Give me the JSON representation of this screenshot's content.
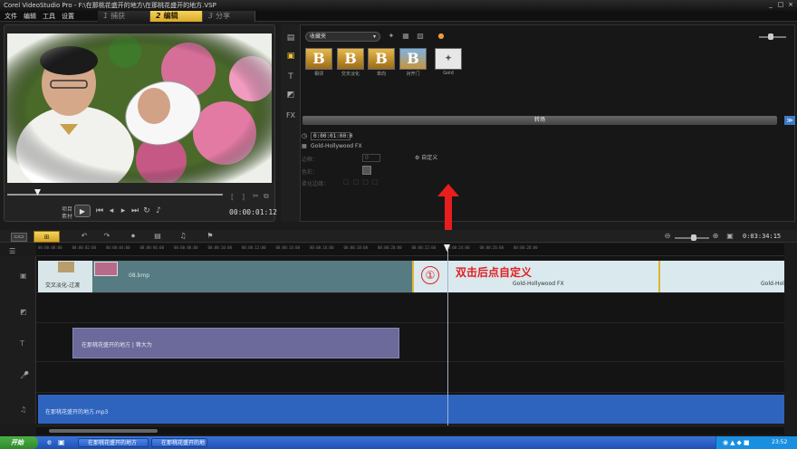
{
  "window": {
    "title": "Corel VideoStudio Pro - F:\\在那桃花盛开的地方\\在那桃花盛开的地方.VSP",
    "controls": [
      "_",
      "□",
      "×"
    ]
  },
  "menu": [
    "文件",
    "编辑",
    "工具",
    "设置"
  ],
  "steps": [
    {
      "num": "1",
      "label": "捕获"
    },
    {
      "num": "2",
      "label": "编辑"
    },
    {
      "num": "3",
      "label": "分享"
    }
  ],
  "preview": {
    "project_label": "项目",
    "clip_label": "素材",
    "timecode": "00:00:01:12"
  },
  "library": {
    "folder": "收藏夹",
    "thumbnails": [
      {
        "glyph": "B",
        "label": "相邻"
      },
      {
        "glyph": "B",
        "label": "交叉淡化"
      },
      {
        "glyph": "B",
        "label": "单向"
      },
      {
        "glyph": "B",
        "label": "对开门"
      },
      {
        "glyph": "✦",
        "label": "Gold"
      }
    ],
    "transition_header": "转场",
    "options": {
      "duration": "0:00:01:00:0",
      "effect_name": "Gold-Hollywood FX",
      "border_label": "边框：",
      "border_value": "0",
      "color_label": "色彩：",
      "soft_edge_label": "柔化边缘：",
      "custom_button": "自定义"
    }
  },
  "timeline": {
    "timecode": "0:03:34:15",
    "ruler_ticks": [
      "00:00:00:00",
      "00:00:02:00",
      "00:00:04:00",
      "00:00:06:00",
      "00:00:08:00",
      "00:00:10:00",
      "00:00:12:00",
      "00:00:14:00",
      "00:00:16:00",
      "00:00:18:00",
      "00:00:20:00",
      "00:00:22:00",
      "00:00:24:00",
      "00:00:26:00",
      "00:00:28:00"
    ],
    "video_track": {
      "clip1": "交叉淡化-过渡",
      "clip_main": "08.bmp",
      "transition_marker": "①",
      "annotation": "双击后点自定义",
      "gold_clip": "Gold-Hollywood FX",
      "gold_clip2": "Gold-Hol"
    },
    "title_clip": "在那桃花盛开的地方 | 蒋大为",
    "music_clip": "在那桃花盛开的地方.mp3"
  },
  "taskbar": {
    "start": "开始",
    "tasks": [
      "在那桃花盛开的地方",
      "在那桃花盛开的地"
    ],
    "clock": "23:52"
  },
  "colors": {
    "accent": "#e0b531",
    "annotation_red": "#e02020",
    "music_track": "#2f64be"
  }
}
